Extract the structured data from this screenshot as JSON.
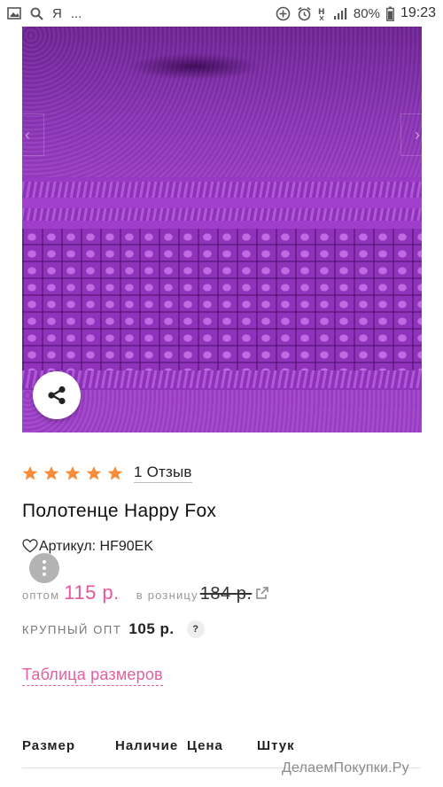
{
  "status_bar": {
    "left_icons": [
      "image-icon",
      "search-icon"
    ],
    "app_letter": "Я",
    "overflow": "...",
    "right_icons": [
      "data-saver-icon",
      "alarm-icon",
      "h-plus-icon",
      "signal-icon",
      "battery-icon"
    ],
    "network_label": "H",
    "battery": "80%",
    "time": "19:23"
  },
  "product": {
    "image_colors": {
      "main": "#9436c0",
      "dark": "#6f2496",
      "light": "#c06be4"
    },
    "rating": {
      "stars": 5,
      "max": 5,
      "star_color": "#f58d3b"
    },
    "reviews_label": "1 Отзыв",
    "title": "Полотенце Happy Fox",
    "sku_label": "Артикул: HF90EK"
  },
  "pricing": {
    "wholesale_label": "оптом",
    "wholesale_price": "115 р.",
    "retail_label": "в розницу",
    "retail_price": "184 р.",
    "bulk_label": "крупный опт",
    "bulk_price": "105 р.",
    "help_symbol": "?",
    "accent": "#e8559b"
  },
  "size_chart_link": "Таблица размеров",
  "table": {
    "headers": [
      "Размер",
      "Наличие",
      "Цена",
      "Штук"
    ]
  },
  "watermark": "ДелаемПокупки.Ру"
}
